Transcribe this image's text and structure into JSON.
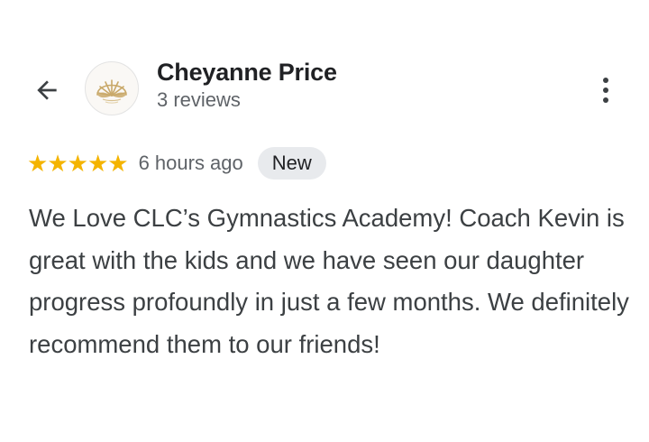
{
  "review": {
    "author": {
      "name": "Cheyanne Price",
      "review_count": "3 reviews",
      "avatar_icon": "seashell-logo-icon"
    },
    "rating": 5,
    "max_rating": 5,
    "time_ago": "6 hours ago",
    "badge": "New",
    "text": "We Love CLC’s Gymnastics Academy! Coach Kevin is great with the kids and we have seen our daughter progress profoundly in just a few months. We definitely recommend them to our friends!"
  },
  "header": {
    "back_icon": "arrow-back-icon",
    "more_icon": "more-vert-icon"
  },
  "colors": {
    "star": "#f4b400",
    "badge_bg": "#e8eaed",
    "secondary_text": "#5f6368",
    "body_text": "#3c4043"
  }
}
